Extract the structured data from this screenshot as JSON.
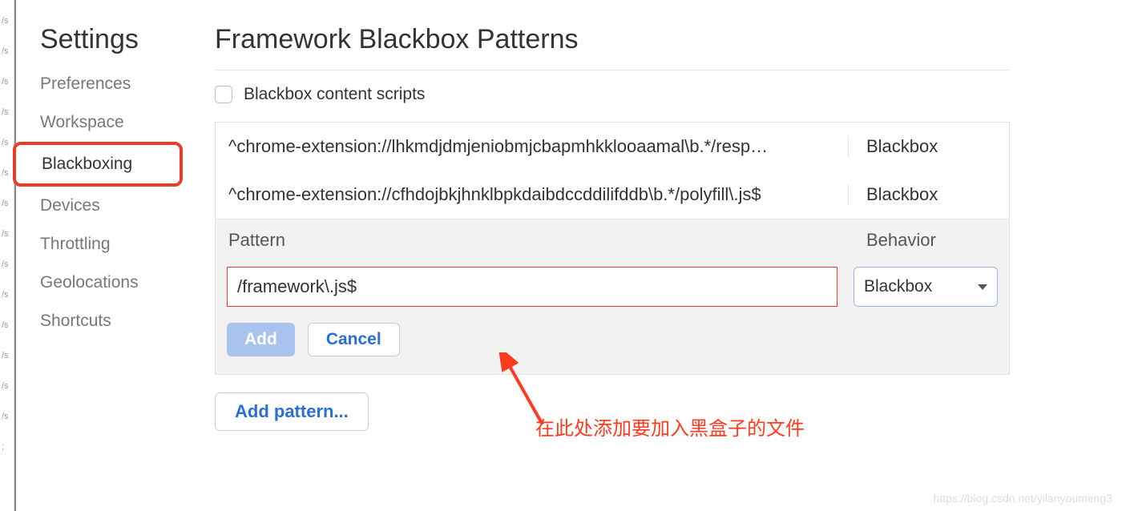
{
  "edge": [
    "/s",
    "/s",
    "/s",
    "/s",
    "/s",
    "/s",
    "/s",
    "/s",
    "/s",
    "/s",
    "/s",
    "/s",
    "/s",
    "/s",
    ";"
  ],
  "sidebar": {
    "title": "Settings",
    "items": [
      {
        "label": "Preferences",
        "active": false
      },
      {
        "label": "Workspace",
        "active": false
      },
      {
        "label": "Blackboxing",
        "active": true
      },
      {
        "label": "Devices",
        "active": false
      },
      {
        "label": "Throttling",
        "active": false
      },
      {
        "label": "Geolocations",
        "active": false
      },
      {
        "label": "Shortcuts",
        "active": false
      }
    ]
  },
  "page": {
    "title": "Framework Blackbox Patterns",
    "checkbox_label": "Blackbox content scripts",
    "checkbox_checked": false
  },
  "table": {
    "header_pattern": "Pattern",
    "header_behavior": "Behavior",
    "rows": [
      {
        "pattern": "^chrome-extension://lhkmdjdmjeniobmjcbapmhkklooaamal\\b.*/resp…",
        "behavior": "Blackbox"
      },
      {
        "pattern": "^chrome-extension://cfhdojbkjhnklbpkdaibdccddilifddb\\b.*/polyfill\\.js$",
        "behavior": "Blackbox"
      }
    ]
  },
  "form": {
    "pattern_value": "/framework\\.js$",
    "behavior_value": "Blackbox",
    "add_label": "Add",
    "cancel_label": "Cancel"
  },
  "add_pattern_label": "Add pattern...",
  "annotation_text": "在此处添加要加入黑盒子的文件",
  "watermark": "https://blog.csdn.net/yilanyoumeng3"
}
